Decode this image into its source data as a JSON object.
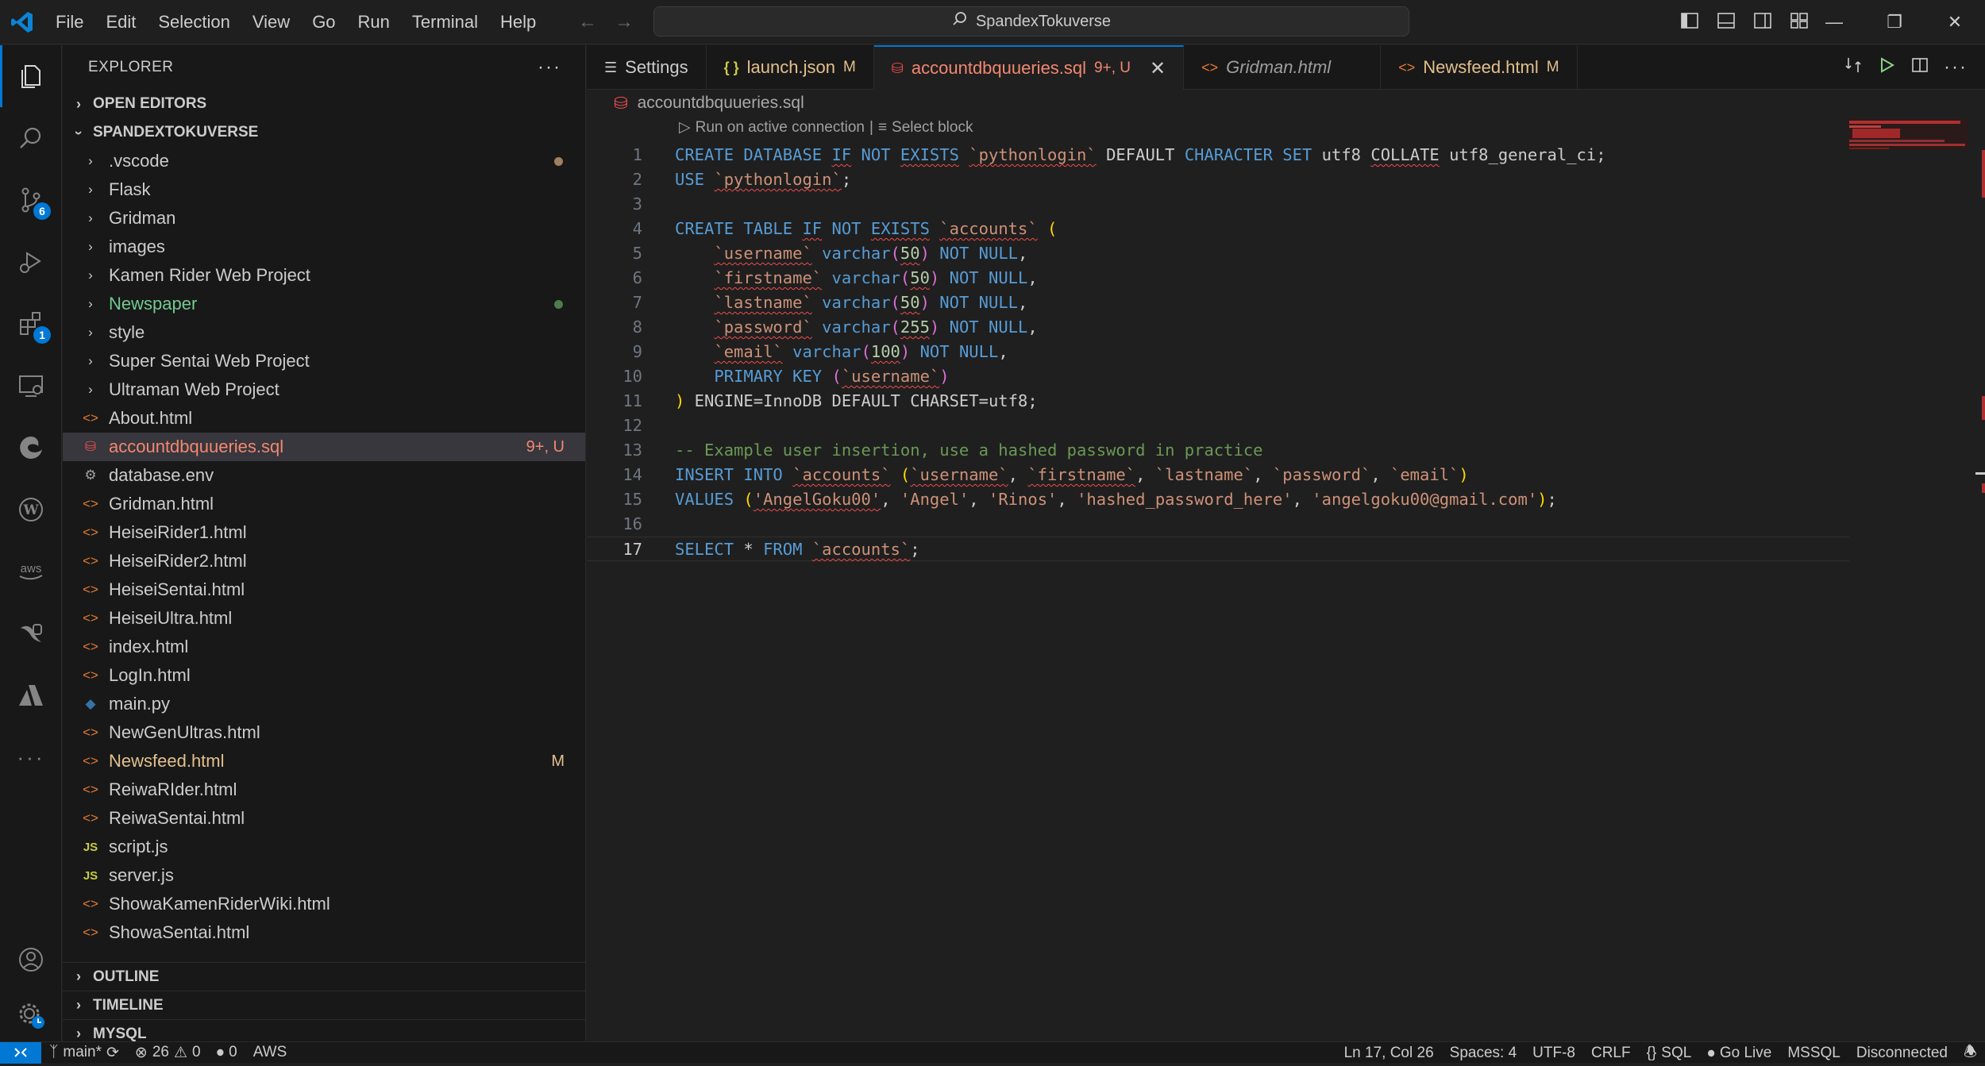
{
  "menu": [
    "File",
    "Edit",
    "Selection",
    "View",
    "Go",
    "Run",
    "Terminal",
    "Help"
  ],
  "search_title": "SpandexTokuverse",
  "activity_badges": {
    "source_control": "6",
    "extensions": "1"
  },
  "sidebar": {
    "title": "EXPLORER",
    "open_editors": "OPEN EDITORS",
    "workspace": "SPANDEXTOKUVERSE",
    "items": [
      {
        "name": ".vscode",
        "kind": "folder",
        "dot": "#a08060"
      },
      {
        "name": "Flask",
        "kind": "folder"
      },
      {
        "name": "Gridman",
        "kind": "folder"
      },
      {
        "name": "images",
        "kind": "folder"
      },
      {
        "name": "Kamen Rider Web Project",
        "kind": "folder"
      },
      {
        "name": "Newspaper",
        "kind": "folder",
        "dot": "#4d7c4d"
      },
      {
        "name": "style",
        "kind": "folder"
      },
      {
        "name": "Super Sentai Web Project",
        "kind": "folder"
      },
      {
        "name": "Ultraman Web Project",
        "kind": "folder"
      },
      {
        "name": "About.html",
        "kind": "html"
      },
      {
        "name": "accountdbquueries.sql",
        "kind": "sql",
        "status": "9+, U"
      },
      {
        "name": "database.env",
        "kind": "env"
      },
      {
        "name": "Gridman.html",
        "kind": "html"
      },
      {
        "name": "HeiseiRider1.html",
        "kind": "html"
      },
      {
        "name": "HeiseiRider2.html",
        "kind": "html"
      },
      {
        "name": "HeiseiSentai.html",
        "kind": "html"
      },
      {
        "name": "HeiseiUltra.html",
        "kind": "html"
      },
      {
        "name": "index.html",
        "kind": "html"
      },
      {
        "name": "LogIn.html",
        "kind": "html"
      },
      {
        "name": "main.py",
        "kind": "py"
      },
      {
        "name": "NewGenUltras.html",
        "kind": "html"
      },
      {
        "name": "Newsfeed.html",
        "kind": "html",
        "status": "M"
      },
      {
        "name": "ReiwaRIder.html",
        "kind": "html"
      },
      {
        "name": "ReiwaSentai.html",
        "kind": "html"
      },
      {
        "name": "script.js",
        "kind": "js"
      },
      {
        "name": "server.js",
        "kind": "js"
      },
      {
        "name": "ShowaKamenRiderWiki.html",
        "kind": "html"
      },
      {
        "name": "ShowaSentai.html",
        "kind": "html"
      }
    ],
    "outline": "OUTLINE",
    "timeline": "TIMELINE",
    "mysql": "MYSQL"
  },
  "tabs": [
    {
      "label": "Settings",
      "icon": "settings-icon",
      "status": ""
    },
    {
      "label": "launch.json",
      "icon": "json-icon",
      "status": "M"
    },
    {
      "label": "accountdbquueries.sql",
      "icon": "database-icon",
      "status": "9+, U",
      "active": true
    },
    {
      "label": "Gridman.html",
      "icon": "html-icon",
      "status": ""
    },
    {
      "label": "Newsfeed.html",
      "icon": "html-icon",
      "status": "M"
    }
  ],
  "breadcrumb": "accountdbquueries.sql",
  "codelens": {
    "run": "Run on active connection",
    "sep": "|",
    "select": "Select block"
  },
  "code_lines": [
    "1",
    "2",
    "3",
    "4",
    "5",
    "6",
    "7",
    "8",
    "9",
    "10",
    "11",
    "12",
    "13",
    "14",
    "15",
    "16",
    "17"
  ],
  "status": {
    "branch": "main*",
    "errors": "26",
    "warnings": "0",
    "ports": "0",
    "aws": "AWS",
    "position": "Ln 17, Col 26",
    "spaces": "Spaces: 4",
    "encoding": "UTF-8",
    "eol": "CRLF",
    "language": "SQL",
    "golive": "Go Live",
    "mssql": "MSSQL",
    "connection": "Disconnected"
  }
}
